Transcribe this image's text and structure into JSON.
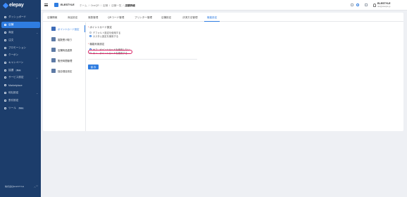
{
  "sidebar": {
    "logo": "elepay",
    "items": [
      {
        "label": "ダッシュボード",
        "icon": "dashboard-icon"
      },
      {
        "label": "店舗",
        "icon": "store-icon",
        "active": true
      },
      {
        "label": "商品",
        "icon": "product-icon",
        "chevron": "⌄"
      },
      {
        "label": "注文",
        "icon": "order-icon"
      },
      {
        "label": "プロモーション",
        "icon": "promotion-icon"
      },
      {
        "label": "クーポン",
        "icon": "coupon-icon"
      },
      {
        "label": "キャンペーン",
        "icon": "campaign-icon"
      },
      {
        "label": "抽選",
        "icon": "lottery-icon",
        "badge": "Beta"
      },
      {
        "label": "サービス設定",
        "icon": "service-icon",
        "chevron": "⌄"
      },
      {
        "label": "Marketplace",
        "icon": "marketplace-icon"
      },
      {
        "label": "他社設定",
        "icon": "settings-icon",
        "chevron": "⌄"
      },
      {
        "label": "割引設定",
        "icon": "discount-icon"
      },
      {
        "label": "ツール",
        "icon": "tool-icon",
        "badge": "Beta"
      }
    ],
    "footer": "株式会社ELESTYLE",
    "footer_arrows": "︿﹀"
  },
  "header": {
    "store_name": "ELESTYLE",
    "breadcrumbs": [
      "ホーム",
      "/",
      "OneQR",
      "/",
      "店舗",
      "/",
      "店舗一覧",
      "/",
      "店舗詳細"
    ],
    "user_name": "ELESTYLE",
    "user_email": "dev@elestyle.jp"
  },
  "tabs": [
    {
      "label": "店舗情報"
    },
    {
      "label": "商品設定"
    },
    {
      "label": "席数管理"
    },
    {
      "label": "QRコード管理"
    },
    {
      "label": "プリンター管理"
    },
    {
      "label": "店舗設定"
    },
    {
      "label": "決済方法管理"
    },
    {
      "label": "機能設定",
      "active": true
    }
  ],
  "subnav": [
    {
      "label": "ポイントカード設定",
      "active": true
    },
    {
      "label": "複数受け取り"
    },
    {
      "label": "店舗商品連携"
    },
    {
      "label": "販売時間管理"
    },
    {
      "label": "独自項目設定"
    }
  ],
  "form": {
    "section1_title": "ポイントカード設定",
    "section1_options": [
      "デフォルト設定を使用する",
      "カスタム設定を使用する"
    ],
    "section1_selected": 1,
    "section2_title": "機能利用設定",
    "section2_options": [
      "オフ - ポイントカードを使用しない",
      "オン - ポイントカードを使用する"
    ],
    "section2_selected": 0,
    "required_mark": "*",
    "save_label": "保 存"
  },
  "colors": {
    "sidebar_bg": "#1c3d6b",
    "accent": "#2f7de1",
    "highlight": "#d81b60"
  }
}
